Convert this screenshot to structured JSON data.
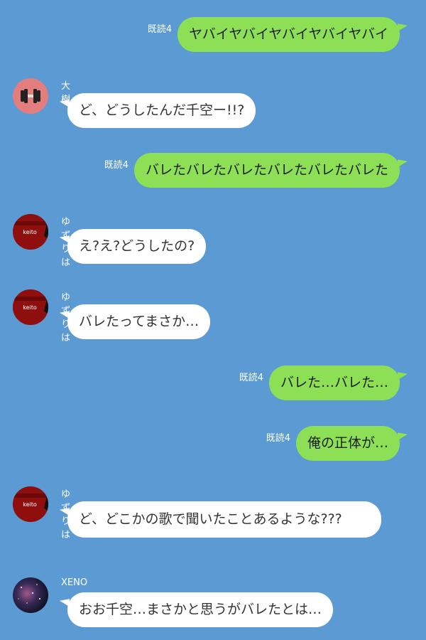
{
  "messages": [
    {
      "side": "out",
      "read": "既読4",
      "text": "ヤバイヤバイヤバイヤバイヤバイ"
    },
    {
      "side": "in",
      "sender": "大樹",
      "avatar": "dumbbell-avatar",
      "text": "ど、どうしたんだ千空ー!!?"
    },
    {
      "side": "out",
      "read": "既読4",
      "text": "バレたバレたバレたバレたバレたバレた"
    },
    {
      "side": "in",
      "sender": "ゆずりは",
      "avatar": "keito-avatar",
      "text": "え?え?どうしたの?"
    },
    {
      "side": "in",
      "sender": "ゆずりは",
      "avatar": "keito-avatar",
      "text": "バレたってまさか…"
    },
    {
      "side": "out",
      "read": "既読4",
      "text": "バレた…バレた…"
    },
    {
      "side": "out",
      "read": "既読4",
      "text": "俺の正体が…"
    },
    {
      "side": "in",
      "sender": "ゆずりは",
      "avatar": "keito-avatar",
      "text": "ど、どこかの歌で聞いたことあるような???"
    },
    {
      "side": "in",
      "sender": "XENO",
      "avatar": "galaxy-avatar",
      "text": "おお千空…まさかと思うがバレたとは…"
    }
  ],
  "avatar_text": {
    "keito": "keito"
  },
  "colors": {
    "background": "#5b9ad2",
    "outgoing_bubble": "#8de055",
    "incoming_bubble": "#ffffff"
  }
}
